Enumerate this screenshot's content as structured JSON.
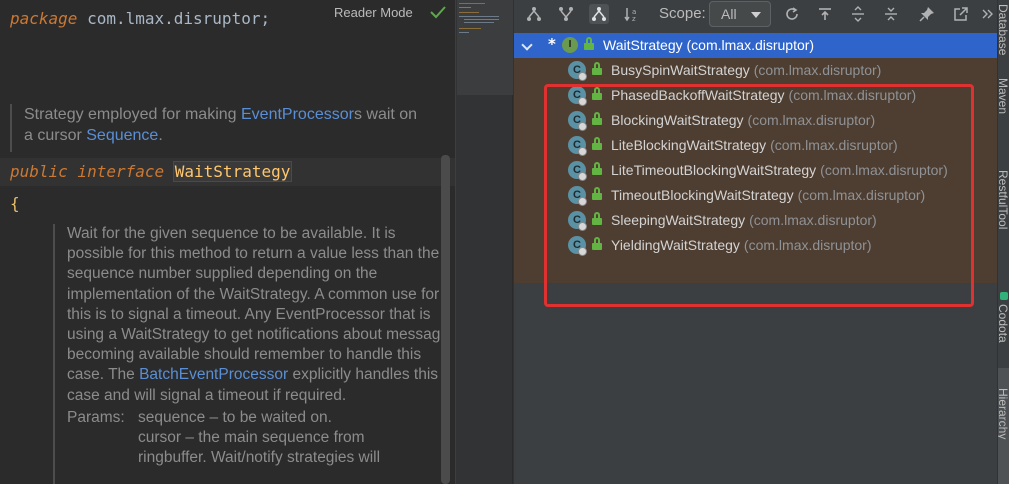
{
  "editor": {
    "package_keyword": "package",
    "package_name": " com.lmax.disruptor;",
    "reader_mode_label": "Reader Mode",
    "doc_comment_1": {
      "text_before": "Strategy employed for making ",
      "link_1": "EventProcessor",
      "text_mid": "s wait on a cursor ",
      "link_2": "Sequence",
      "text_after": "."
    },
    "interface_keywords": "public interface ",
    "interface_name": "WaitStrategy",
    "open_brace": "{",
    "doc_comment_2": {
      "paragraph": "Wait for the given sequence to be available. It is possible for this method to return a value less than the sequence number supplied depending on the implementation of the WaitStrategy. A common use for this is to signal a timeout. Any EventProcessor that is using a WaitStrategy to get notifications about message becoming available should remember to handle this case. The ",
      "link": "BatchEventProcessor",
      "paragraph_end": " explicitly handles this case and will signal a timeout if required.",
      "params_label": "Params:",
      "params": [
        "sequence – to be waited on.",
        "cursor – the main sequence from",
        "ringbuffer. Wait/notify strategies will"
      ]
    }
  },
  "hierarchy": {
    "toolbar": {
      "scope_label": "Scope:",
      "scope_value": "All",
      "icons": [
        "supertypes-hierarchy-icon",
        "subtypes-hierarchy-icon",
        "class-hierarchy-icon",
        "sort-alphabetically-icon",
        "refresh-icon",
        "export-icon",
        "expand-all-icon",
        "collapse-all-icon",
        "pin-icon",
        "open-in-new-icon"
      ]
    },
    "root": {
      "marker": "*",
      "icon_letter": "I",
      "label": "WaitStrategy (com.lmax.disruptor)"
    },
    "children": [
      {
        "name": "BusySpinWaitStrategy",
        "package": "(com.lmax.disruptor)"
      },
      {
        "name": "PhasedBackoffWaitStrategy",
        "package": "(com.lmax.disruptor)"
      },
      {
        "name": "BlockingWaitStrategy",
        "package": "(com.lmax.disruptor)"
      },
      {
        "name": "LiteBlockingWaitStrategy",
        "package": "(com.lmax.disruptor)"
      },
      {
        "name": "LiteTimeoutBlockingWaitStrategy",
        "package": "(com.lmax.disruptor)"
      },
      {
        "name": "TimeoutBlockingWaitStrategy",
        "package": "(com.lmax.disruptor)"
      },
      {
        "name": "SleepingWaitStrategy",
        "package": "(com.lmax.disruptor)"
      },
      {
        "name": "YieldingWaitStrategy",
        "package": "(com.lmax.disruptor)"
      }
    ],
    "child_icon_letter": "C"
  },
  "right_strip": {
    "tabs": [
      "Database",
      "Maven",
      "RestfulTool",
      "Codota",
      "Hierarchy"
    ]
  },
  "colors": {
    "selection": "#2f65ca",
    "children_background": "#4e3e31",
    "highlight_box": "#e03131",
    "keyword": "#cc7832",
    "type_name": "#ffc66d",
    "doc_link": "#5a8fd6"
  }
}
